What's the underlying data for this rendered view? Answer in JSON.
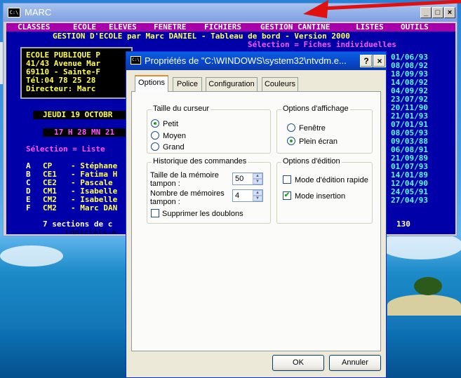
{
  "dos_window": {
    "title": "MARC",
    "icon_text": "C:\\",
    "buttons": {
      "minimize": "_",
      "maximize": "□",
      "close": "×"
    },
    "menu": [
      "CLASSES",
      "ECOLE",
      "ELEVES",
      "FENETRE",
      "FICHIERS",
      "GESTION CANTINE",
      "LISTES",
      "OUTILS"
    ],
    "header": "GESTION D'ECOLE par Marc DANIEL - Tableau de bord - Version 2000",
    "selection_right": "Sélection = Fiches individuelles",
    "school": [
      "ECOLE PUBLIQUE P",
      "41/43 Avenue Mar",
      "69110 - Sainte-F",
      "Tél:04 78 25 28",
      "Directeur: Marc"
    ],
    "date": "JEUDI 19 OCTOBR",
    "time": "17 H 28 MN 21",
    "selection_left": "Sélection = Liste",
    "classes": [
      {
        "letter": "A",
        "level": "CP",
        "teacher": "- Stéphane"
      },
      {
        "letter": "B",
        "level": "CE1",
        "teacher": "- Fatima H"
      },
      {
        "letter": "C",
        "level": "CE2",
        "teacher": "- Pascale"
      },
      {
        "letter": "D",
        "level": "CM1",
        "teacher": "- Isabelle"
      },
      {
        "letter": "E",
        "level": "CM2",
        "teacher": "- Isabelle"
      },
      {
        "letter": "F",
        "level": "CM2",
        "teacher": "- Marc DAN"
      }
    ],
    "footer_left": "7 sections de c",
    "footer_right": "130",
    "footer_sub": "Logiciels e",
    "dates": [
      "01/06/93",
      "08/08/92",
      "18/09/93",
      "14/08/92",
      "04/09/92",
      "23/07/92",
      "20/11/90",
      "21/01/93",
      "07/01/91",
      "08/05/93",
      "09/03/88",
      "06/08/91",
      "21/09/89",
      "01/07/93",
      "14/01/89",
      "12/04/90",
      "24/05/91",
      "27/04/93"
    ]
  },
  "dialog": {
    "title": "Propriétés de \"C:\\WINDOWS\\system32\\ntvdm.e...",
    "help_button": "?",
    "close_button": "×",
    "tabs": [
      "Options",
      "Police",
      "Configuration",
      "Couleurs"
    ],
    "active_tab": "Options",
    "cursor_group": {
      "label": "Taille du curseur",
      "options": [
        "Petit",
        "Moyen",
        "Grand"
      ],
      "selected": "Petit"
    },
    "display_group": {
      "label": "Options d'affichage",
      "options": [
        "Fenêtre",
        "Plein écran"
      ],
      "selected": "Plein écran"
    },
    "history_group": {
      "label": "Historique des commandes",
      "buffer_size_label_1": "Taille de la mémoire",
      "buffer_size_label_2": "tampon :",
      "buffer_size_value": "50",
      "buffer_count_label_1": "Nombre de mémoires",
      "buffer_count_label_2": "tampon :",
      "buffer_count_value": "4",
      "discard_duplicates": "Supprimer les doublons",
      "discard_duplicates_checked": false
    },
    "edit_group": {
      "label": "Options d'édition",
      "quick_edit": "Mode d'édition rapide",
      "quick_edit_checked": false,
      "insert_mode": "Mode insertion",
      "insert_mode_checked": true
    },
    "ok_button": "OK",
    "cancel_button": "Annuler"
  }
}
